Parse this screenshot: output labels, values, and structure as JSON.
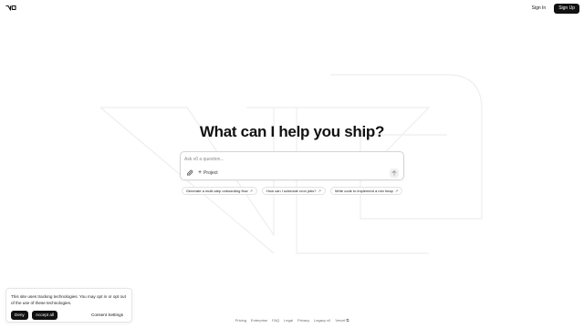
{
  "header": {
    "logo_icon": "v0-logo-icon",
    "signin_label": "Sign In",
    "signup_label": "Sign Up"
  },
  "hero": {
    "headline": "What can I help you ship?"
  },
  "prompt": {
    "placeholder": "Ask v0 a question...",
    "attach_icon": "paperclip-icon",
    "project_label": "Project",
    "send_icon": "arrow-up-icon"
  },
  "suggestions": [
    {
      "label": "Generate a multi-step onboarding flow",
      "icon": "arrow-up-right-icon"
    },
    {
      "label": "How can I schedule cron jobs?",
      "icon": "arrow-up-right-icon"
    },
    {
      "label": "Write code to implement a min heap",
      "icon": "arrow-up-right-icon"
    }
  ],
  "cookie": {
    "message": "This site uses tracking technologies. You may opt in or opt out of the use of these technologies.",
    "deny_label": "Deny",
    "accept_label": "Accept all",
    "settings_label": "Consent Settings"
  },
  "footer": {
    "links": [
      "Pricing",
      "Enterprise",
      "FAQ",
      "Legal",
      "Privacy",
      "Legacy v0",
      "Vercel"
    ],
    "external_icon": "external-link-icon"
  },
  "colors": {
    "primary": "#111111",
    "background": "#ffffff",
    "muted_text": "#6b6b6b",
    "border": "#e2e2e2"
  }
}
